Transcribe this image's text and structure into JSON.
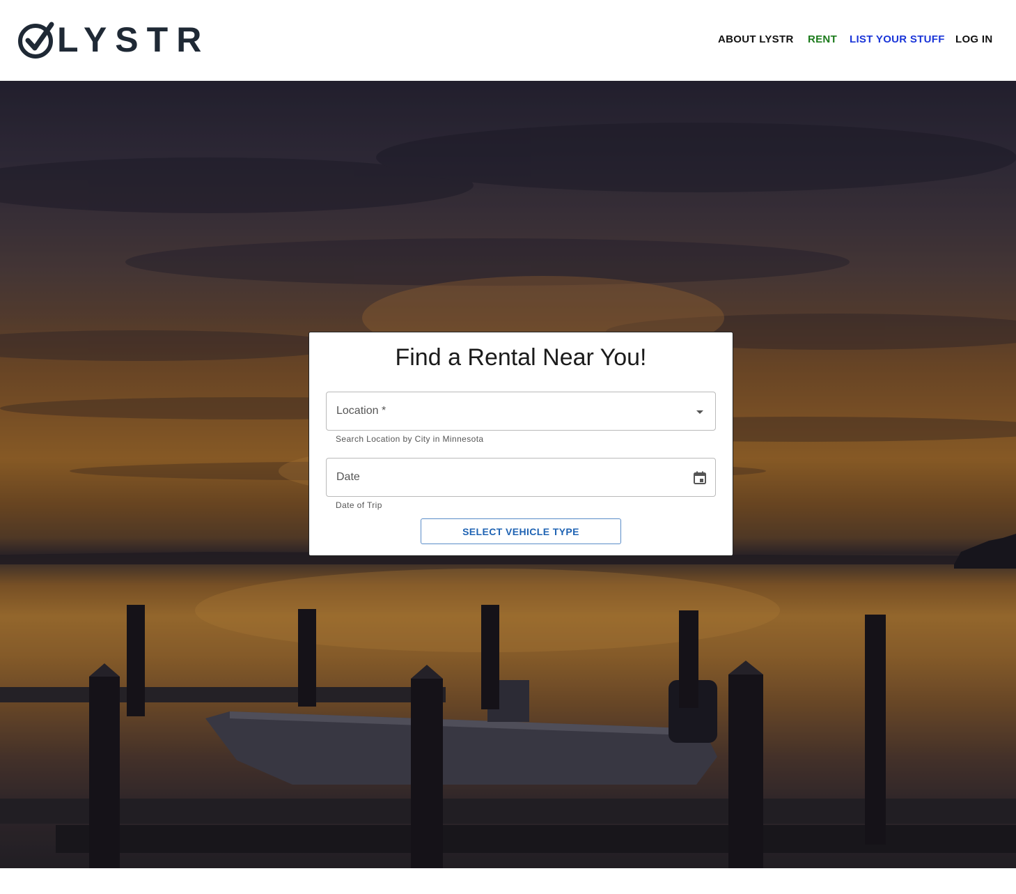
{
  "header": {
    "logo_text": "LYSTR",
    "nav": {
      "about": "ABOUT LYSTR",
      "rent": "RENT",
      "list": "LIST YOUR STUFF",
      "login": "LOG IN"
    }
  },
  "search_card": {
    "title": "Find a Rental Near You!",
    "location": {
      "label": "Location *",
      "helper": "Search Location by City in Minnesota",
      "icon": "arrow-drop-down-icon"
    },
    "date": {
      "label": "Date",
      "helper": "Date of Trip",
      "icon": "calendar-icon"
    },
    "button_label": "SELECT VEHICLE TYPE"
  },
  "colors": {
    "nav_rent": "#1b7a1b",
    "nav_list": "#1a35d8",
    "button_text": "#1f63b3",
    "logo": "#1f2935"
  }
}
